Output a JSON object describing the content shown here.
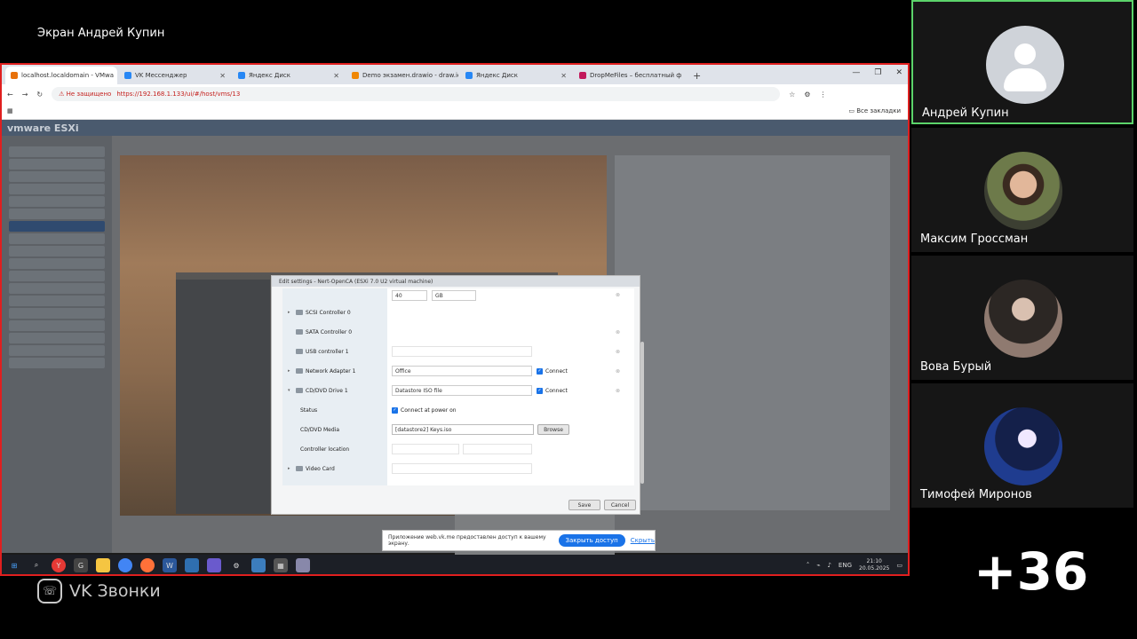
{
  "share": {
    "title": "Экран Андрей Купин"
  },
  "browser": {
    "tabs": [
      {
        "label": "localhost.localdomain - VMwa",
        "color": "#e8710a",
        "active": true
      },
      {
        "label": "VK Мессенджер",
        "color": "#2787f5",
        "active": false
      },
      {
        "label": "Яндекс Диск",
        "color": "#2787f5",
        "active": false
      },
      {
        "label": "Demo экзамен.drawio - draw.io",
        "color": "#f08705",
        "active": false
      },
      {
        "label": "Яндекс Диск",
        "color": "#2787f5",
        "active": false
      },
      {
        "label": "DropMeFiles – бесплатный ф",
        "color": "#c2185b",
        "active": false
      }
    ],
    "not_secure": "Не защищено",
    "url": "https://192.168.1.133/ui/#/host/vms/13",
    "all_bookmarks": "Все закладки"
  },
  "esxi": {
    "logo": "vmware ESXi"
  },
  "dialog": {
    "title": "Edit settings - Nert-OpenCA (ESXi 7.0 U2 virtual machine)",
    "hard_disk_value": "40",
    "hard_disk_unit": "GB",
    "rows": {
      "scsi": "SCSI Controller 0",
      "sata": "SATA Controller 0",
      "usb": "USB controller 1",
      "network": "Network Adapter 1",
      "cddvd": "CD/DVD Drive 1",
      "status": "Status",
      "media": "CD/DVD Media",
      "controller_location": "Controller location",
      "video": "Video Card"
    },
    "network_value": "Office",
    "cddvd_value": "Datastore ISO file",
    "connect_label": "Connect",
    "connect_power_on": "Connect at power on",
    "media_value": "[datastore2] Keys.iso",
    "browse": "Browse",
    "save": "Save",
    "cancel": "Cancel"
  },
  "notice": {
    "text": "Приложение web.vk.me предоставлен доступ к вашему экрану.",
    "stop": "Закрыть доступ",
    "hide": "Скрыть"
  },
  "taskbar": {
    "lang": "ENG",
    "time": "21:10",
    "date": "20.05.2025"
  },
  "app_brand": "VK Звонки",
  "participants": [
    {
      "name": "Андрей Купин",
      "active": true,
      "avatar": "placeholder"
    },
    {
      "name": "Максим Гроссман",
      "active": false,
      "avatar": "photo"
    },
    {
      "name": "Вова Бурый",
      "active": false,
      "avatar": "photo"
    },
    {
      "name": "Тимофей Миронов",
      "active": false,
      "avatar": "drawing"
    }
  ],
  "more_count": "+36",
  "colors": {
    "share_border": "#e01f1f",
    "active_speaker": "#5bd36a",
    "accent": "#1a73e8"
  }
}
